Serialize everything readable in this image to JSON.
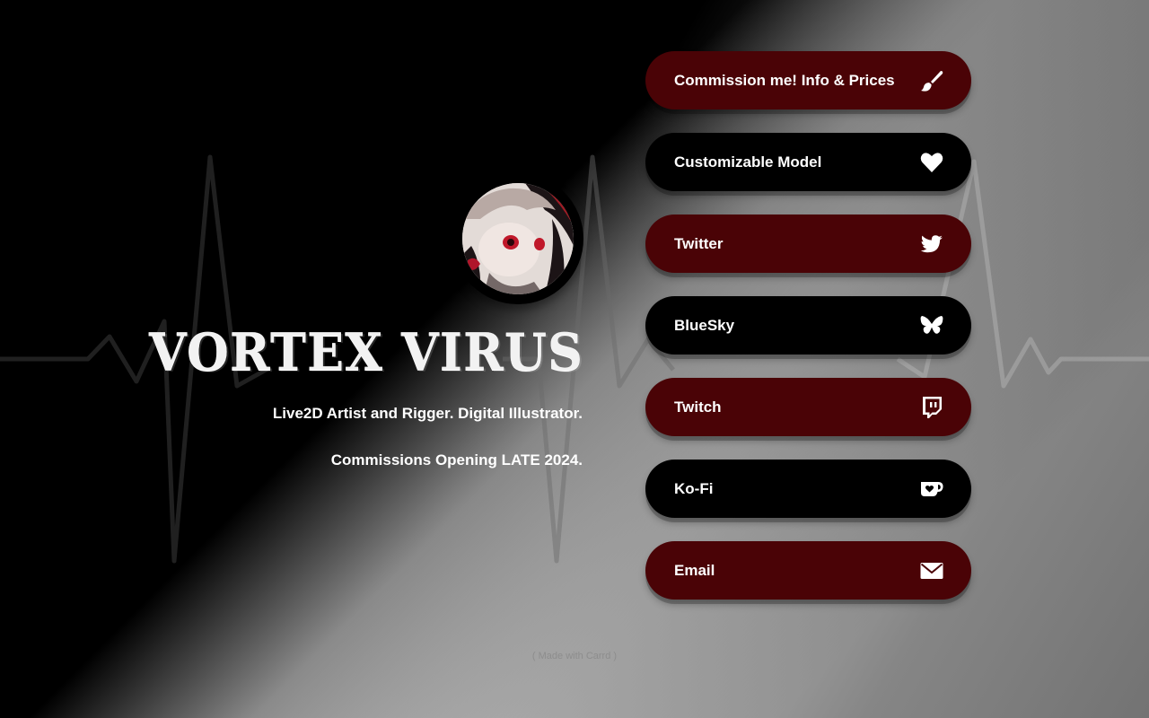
{
  "profile": {
    "name": "Vortex Virus",
    "tagline_1": "Live2D Artist and Rigger. Digital Illustrator.",
    "tagline_2": "Commissions Opening LATE 2024."
  },
  "links": [
    {
      "label": "Commission me! Info & Prices",
      "icon": "paintbrush-icon",
      "style": "red"
    },
    {
      "label": "Customizable Model",
      "icon": "heart-icon",
      "style": "black"
    },
    {
      "label": "Twitter",
      "icon": "twitter-icon",
      "style": "red"
    },
    {
      "label": "BlueSky",
      "icon": "bluesky-butterfly-icon",
      "style": "black"
    },
    {
      "label": "Twitch",
      "icon": "twitch-icon",
      "style": "red"
    },
    {
      "label": "Ko-Fi",
      "icon": "kofi-cup-icon",
      "style": "black"
    },
    {
      "label": "Email",
      "icon": "envelope-icon",
      "style": "red"
    }
  ],
  "footer": {
    "text": "( Made with Carrd )"
  },
  "colors": {
    "button_red": "#4a0306",
    "button_black": "#000000",
    "text": "#ffffff"
  }
}
